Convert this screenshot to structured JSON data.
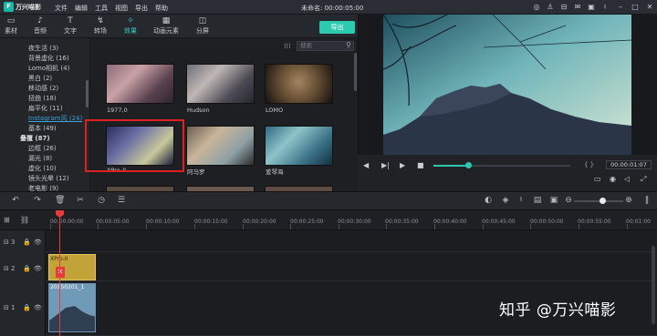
{
  "app": {
    "name": "万兴喵影",
    "logo_glyph": "F",
    "project_title": "未命名:  00:00:05:00"
  },
  "menu": [
    "文件",
    "编辑",
    "工具",
    "视图",
    "导出",
    "帮助"
  ],
  "toolbar": {
    "tabs": [
      {
        "label": "素材",
        "icon": "folder-icon"
      },
      {
        "label": "音频",
        "icon": "music-note-icon"
      },
      {
        "label": "文字",
        "icon": "text-icon"
      },
      {
        "label": "转场",
        "icon": "transition-icon"
      },
      {
        "label": "效果",
        "icon": "effects-icon",
        "active": true
      },
      {
        "label": "动画元素",
        "icon": "image-icon"
      },
      {
        "label": "分屏",
        "icon": "split-screen-icon"
      }
    ],
    "export_label": "导出"
  },
  "categories": [
    {
      "label": "夜生活 (3)"
    },
    {
      "label": "背景虚化 (16)"
    },
    {
      "label": "Lomo相机 (4)"
    },
    {
      "label": "黑白 (2)"
    },
    {
      "label": "移动感 (2)"
    },
    {
      "label": "扭曲 (18)"
    },
    {
      "label": "扁平化 (11)"
    },
    {
      "label": "Instagram风 (24)",
      "selected": true
    },
    {
      "label": "基本 (49)"
    },
    {
      "label": "叠覆 (87)",
      "group": true
    },
    {
      "label": "边框 (26)"
    },
    {
      "label": "漏光 (8)"
    },
    {
      "label": "虚化 (10)"
    },
    {
      "label": "镜头光晕 (12)"
    },
    {
      "label": "老电影 (9)"
    }
  ],
  "search": {
    "placeholder": "搜索"
  },
  "effects": [
    {
      "label": "1977,0"
    },
    {
      "label": "Hudson"
    },
    {
      "label": "LOMO"
    },
    {
      "label": "XPro-II"
    },
    {
      "label": "阿马罗"
    },
    {
      "label": "爱琴海"
    }
  ],
  "preview": {
    "timecode": "00:00:01:07",
    "progress": 0.25,
    "brackets": "{   }"
  },
  "timeline": {
    "ticks": [
      "00:00:00:00",
      "00:00:05:00",
      "00:00:10:00",
      "00:00:15:00",
      "00:00:20:00",
      "00:00:25:00",
      "00:00:30:00",
      "00:00:35:00",
      "00:00:40:00",
      "00:00:45:00",
      "00:00:50:00",
      "00:00:55:00",
      "00:01:00"
    ],
    "tracks": [
      {
        "num": "3"
      },
      {
        "num": "2"
      },
      {
        "num": "1"
      }
    ],
    "fx_clip_label": "XPro-II",
    "video_clip_label": "20150201_1"
  },
  "watermark": "知乎 @万兴喵影",
  "colors": {
    "accent": "#2ccbb0",
    "highlight": "#e02020",
    "playhead": "#e83a3a"
  }
}
